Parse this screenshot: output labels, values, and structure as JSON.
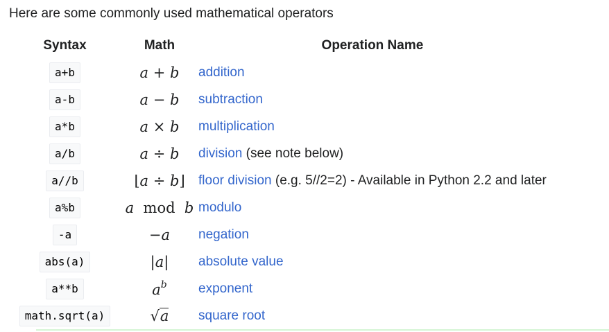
{
  "intro": "Here are some commonly used mathematical operators",
  "headers": {
    "syntax": "Syntax",
    "math": "Math",
    "operation": "Operation Name"
  },
  "rows": [
    {
      "syntax": "a+b",
      "op": "addition",
      "note": ""
    },
    {
      "syntax": "a-b",
      "op": "subtraction",
      "note": ""
    },
    {
      "syntax": "a*b",
      "op": "multiplication",
      "note": ""
    },
    {
      "syntax": "a/b",
      "op": "division",
      "note": " (see note below)"
    },
    {
      "syntax": "a//b",
      "op": "floor division",
      "note": " (e.g. 5//2=2) - Available in Python 2.2 and later"
    },
    {
      "syntax": "a%b",
      "op": "modulo",
      "note": ""
    },
    {
      "syntax": "-a",
      "op": "negation",
      "note": ""
    },
    {
      "syntax": "abs(a)",
      "op": "absolute value",
      "note": ""
    },
    {
      "syntax": "a**b",
      "op": "exponent",
      "note": ""
    },
    {
      "syntax": "math.sqrt(a)",
      "op": "square root",
      "note": ""
    }
  ],
  "math": {
    "add": {
      "a": "a",
      "op": "+",
      "b": "b"
    },
    "sub": {
      "a": "a",
      "op": "−",
      "b": "b"
    },
    "mul": {
      "a": "a",
      "op": "×",
      "b": "b"
    },
    "div": {
      "a": "a",
      "op": "÷",
      "b": "b"
    },
    "floor": {
      "left": "⌊",
      "a": "a",
      "op": "÷",
      "b": "b",
      "right": "⌋"
    },
    "mod": {
      "a": "a",
      "op": "mod",
      "b": "b"
    },
    "neg": {
      "op": "−",
      "a": "a"
    },
    "abs": {
      "left": "|",
      "a": "a",
      "right": "|"
    },
    "exp": {
      "a": "a",
      "b": "b"
    },
    "sqrt": {
      "radical": "√",
      "a": "a"
    }
  },
  "colors": {
    "link": "#3366cc",
    "text": "#202122",
    "code_bg": "#f8f9fa",
    "code_border": "#eaecf0",
    "bottom_line": "#d4f5d4"
  }
}
